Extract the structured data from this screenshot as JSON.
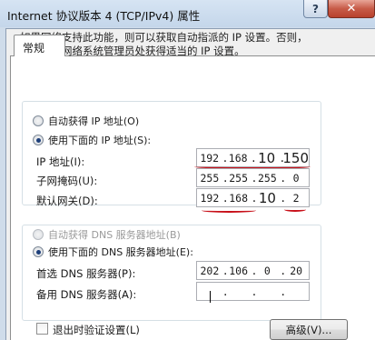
{
  "window": {
    "title": "Internet 协议版本 4 (TCP/IPv4) 属性",
    "help_label": "?",
    "close_label": "✕"
  },
  "tabs": [
    {
      "label": "常规",
      "selected": true
    }
  ],
  "info_text": [
    "如果网络支持此功能，则可以获取自动指派的 IP 设置。否则，",
    "您需要从网络系统管理员处获得适当的 IP 设置。"
  ],
  "ip_section": {
    "auto_option": {
      "label": "自动获得 IP 地址(O)",
      "selected": false
    },
    "manual_option": {
      "label": "使用下面的 IP 地址(S):",
      "selected": true
    },
    "fields": [
      {
        "label": "IP 地址(I):",
        "octets": [
          "192",
          "168",
          "10",
          "150"
        ]
      },
      {
        "label": "子网掩码(U):",
        "octets": [
          "255",
          "255",
          "255",
          "0"
        ]
      },
      {
        "label": "默认网关(D):",
        "octets": [
          "192",
          "168",
          "10",
          "2"
        ]
      }
    ]
  },
  "dns_section": {
    "auto_option": {
      "label": "自动获得 DNS 服务器地址(B)",
      "selected": false,
      "enabled": false
    },
    "manual_option": {
      "label": "使用下面的 DNS 服务器地址(E):",
      "selected": true
    },
    "fields": [
      {
        "label": "首选 DNS 服务器(P):",
        "octets": [
          "202",
          "106",
          "0",
          "20"
        ]
      },
      {
        "label": "备用 DNS 服务器(A):",
        "octets": [
          "",
          "",
          "",
          ""
        ]
      }
    ]
  },
  "validate_on_exit": {
    "label": "退出时验证设置(L)",
    "checked": false
  },
  "advanced_button": {
    "label": "高级(V)..."
  },
  "colors": {
    "annotation_red": "#c8111a",
    "selected_radio": "#1d3f7a"
  }
}
